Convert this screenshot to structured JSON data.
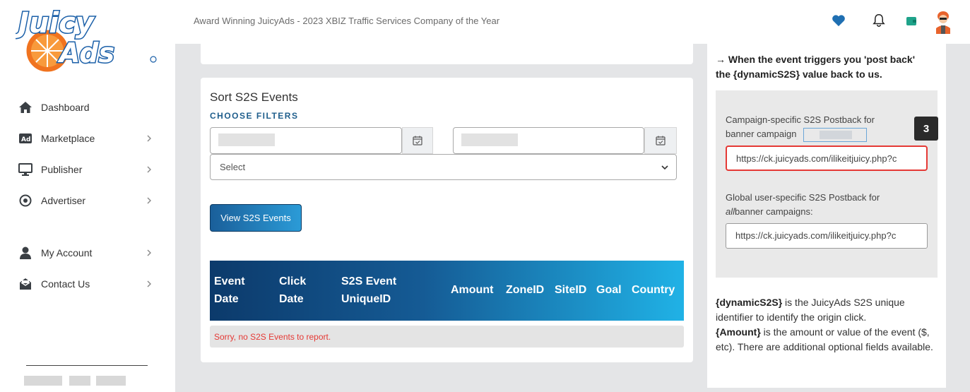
{
  "header": {
    "logo_text_top": "Juicy",
    "logo_text_bottom": "Ads",
    "tagline": "Award Winning JuicyAds - 2023 XBIZ Traffic Services Company of the Year",
    "icons": [
      "heart-icon",
      "bell-icon",
      "wallet-icon",
      "avatar"
    ],
    "colors": {
      "accent": "#1f6fb2",
      "wallet": "#1fa38a"
    }
  },
  "sidebar": {
    "items": [
      {
        "label": "Dashboard",
        "icon": "home-icon"
      },
      {
        "label": "Marketplace",
        "icon": "ad-icon"
      },
      {
        "label": "Publisher",
        "icon": "monitor-icon"
      },
      {
        "label": "Advertiser",
        "icon": "target-icon"
      },
      {
        "label": "My Account",
        "icon": "user-icon"
      },
      {
        "label": "Contact Us",
        "icon": "mail-icon"
      }
    ]
  },
  "main": {
    "title": "Sort S2S Events",
    "filters_label": "CHOOSE FILTERS",
    "select_placeholder": "Select",
    "view_button": "View S2S Events",
    "table_headers": {
      "event_date_1": "Event",
      "event_date_2": "Date",
      "click_date_1": "Click",
      "click_date_2": "Date",
      "s2s_1": "S2S Event",
      "s2s_2": "UniqueID",
      "amount": "Amount",
      "zoneid": "ZoneID",
      "siteid": "SiteID",
      "goal": "Goal",
      "country": "Country"
    },
    "empty_message": "Sorry, no S2S Events to report."
  },
  "right_panel": {
    "heading_line1": "→ When the event triggers you 'post back'",
    "heading_line2": "the {dynamicS2S} value back to us.",
    "campaign_label_a": "Campaign-specific S2S Postback for",
    "campaign_label_b": "banner campaign",
    "campaign_url": "https://ck.juicyads.com/ilikeitjuicy.php?c",
    "global_label_a": "Global user-specific S2S Postback for",
    "global_label_em": "all",
    "global_label_b": "banner campaigns:",
    "global_url": "https://ck.juicyads.com/ilikeitjuicy.php?c",
    "step_badge": "3",
    "foot_term1": "{dynamicS2S}",
    "foot_text1": " is the JuicyAds S2S unique identifier to identify the origin click.",
    "foot_term2": "{Amount}",
    "foot_text2": " is the amount or value of the event ($, etc). There are additional optional fields available."
  }
}
